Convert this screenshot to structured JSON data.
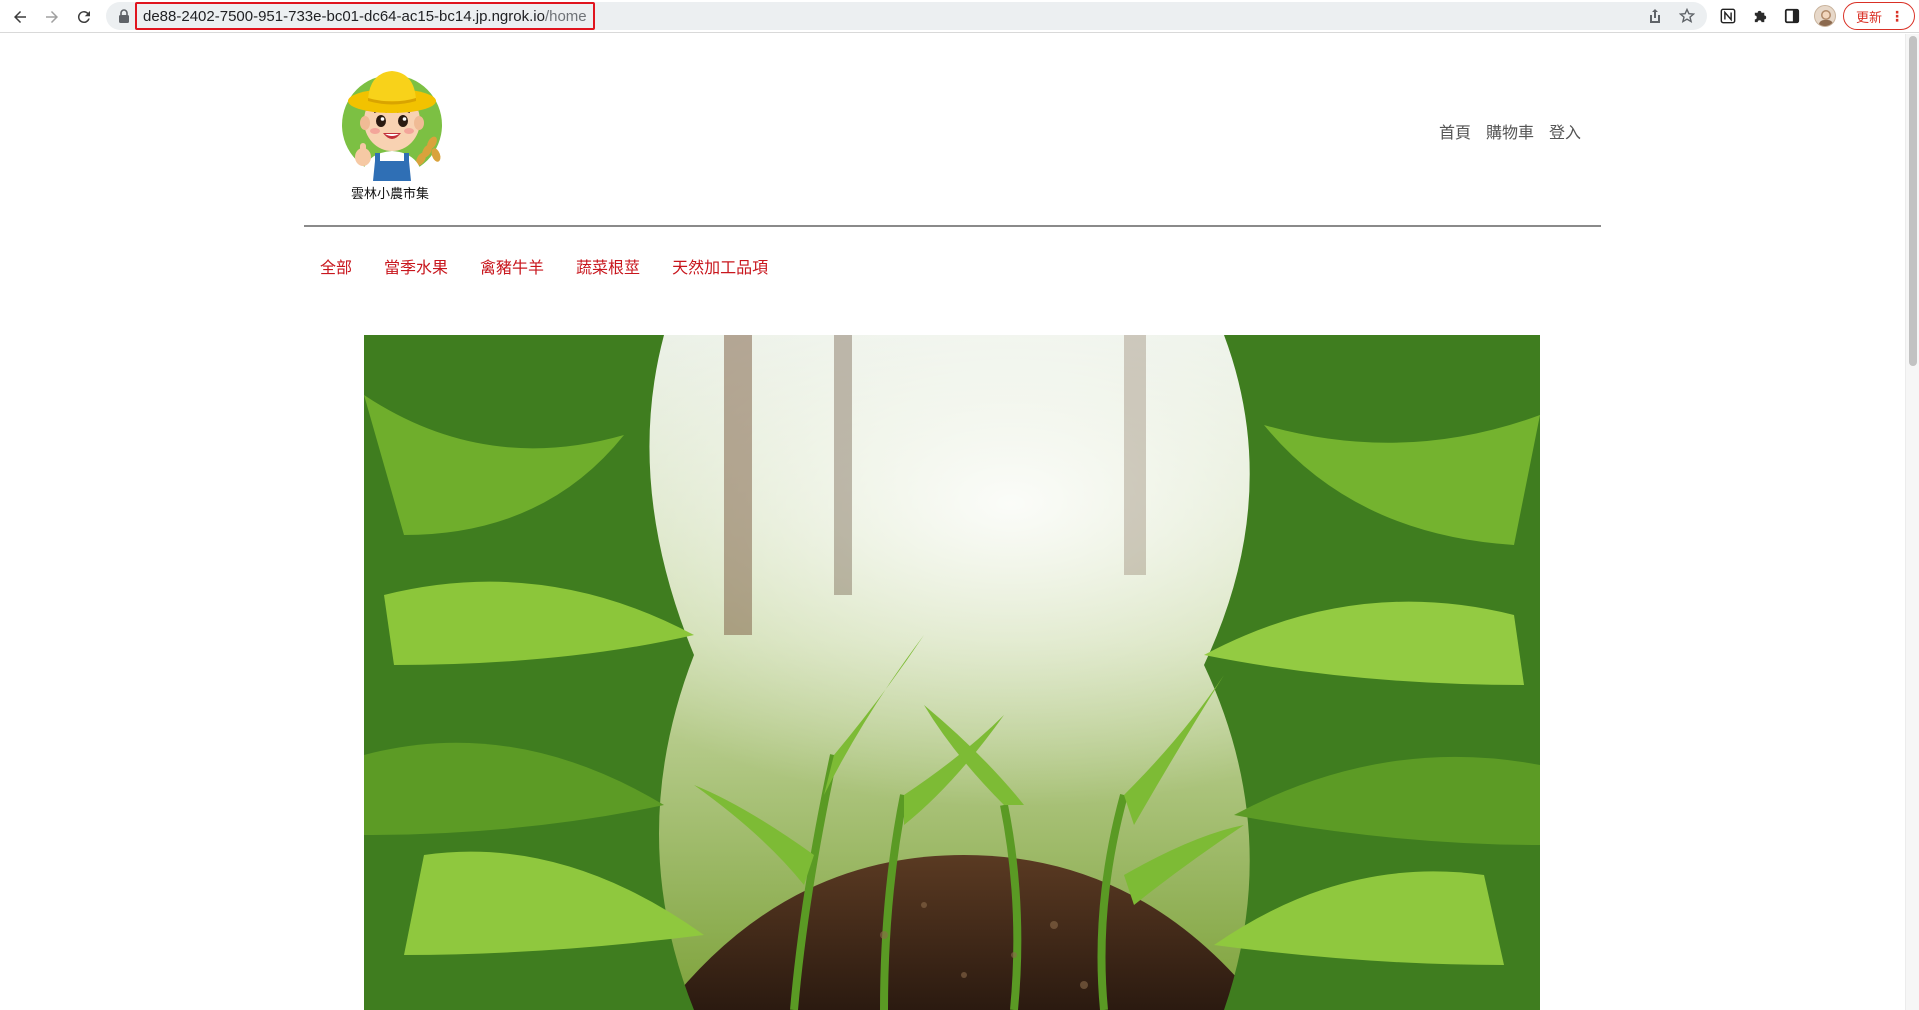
{
  "browser": {
    "url_host": "de88-2402-7500-951-733e-bc01-dc64-ac15-bc14.jp.ngrok.io",
    "url_path": "/home",
    "update_label": "更新",
    "icons": [
      "back-arrow-icon",
      "forward-arrow-icon",
      "reload-icon",
      "lock-icon",
      "share-icon",
      "star-icon",
      "notion-icon",
      "puzzle-icon",
      "sidepanel-icon",
      "kebab-menu-icon"
    ]
  },
  "site": {
    "logo_text": "雲林小農市集",
    "top_nav": [
      {
        "label": "首頁"
      },
      {
        "label": "購物車"
      },
      {
        "label": "登入"
      }
    ],
    "categories": [
      {
        "label": "全部"
      },
      {
        "label": "當季水果"
      },
      {
        "label": "禽豬牛羊"
      },
      {
        "label": "蔬菜根莖"
      },
      {
        "label": "天然加工品項"
      }
    ],
    "hero_image": "corn-field-photo"
  },
  "colors": {
    "category_red": "#c8161d",
    "nav_gray": "#555555",
    "url_highlight": "#e0141e"
  }
}
